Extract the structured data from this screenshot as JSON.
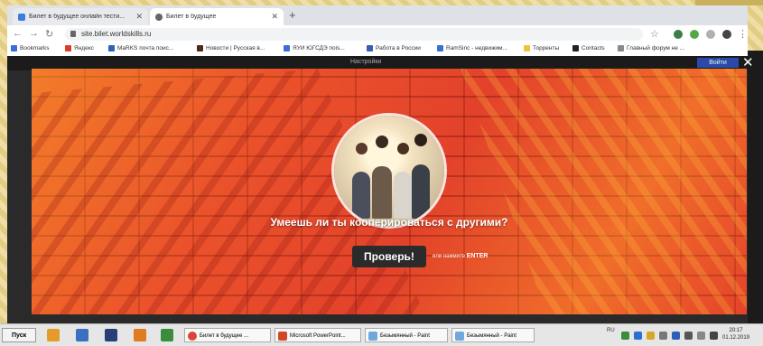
{
  "browser": {
    "tabs": [
      {
        "label": "Билет в будущее онлайн тести..."
      },
      {
        "label": "Билет в будущее"
      }
    ],
    "url": "site.bilet.worldskills.ru",
    "bookmarks": [
      "Bookmarks",
      "Яндекс",
      "MaRKS почта поис...",
      "Новости | Русская в...",
      "ЯУИ ЮГСДЭ поis...",
      "Работа в России",
      "RamSinc - недвижим...",
      "Торренты",
      "Сontacts",
      "Главный форум не ..."
    ]
  },
  "page_header": {
    "center_label": "Настройки",
    "button_label": "Войти"
  },
  "modal": {
    "question": "Умеешь ли ты кооперироваться с другими?",
    "check_button": "Проверь!",
    "skip_prefix": "или нажмите",
    "skip_key": "ENTER"
  },
  "taskbar": {
    "start_label": "Пуск",
    "tasks": [
      "Билет в будущее ...",
      "Microsoft PowerPoint...",
      "Безымянный - Paint",
      "Безымянный - Paint"
    ],
    "lang": "RU",
    "time": "20:17",
    "date": "01.12.2019"
  },
  "colors": {
    "modal_bg": "#e8462a",
    "brick_accent": "#ffa628",
    "button_bg": "#2b2b2b",
    "login_button": "#2b49a8"
  }
}
